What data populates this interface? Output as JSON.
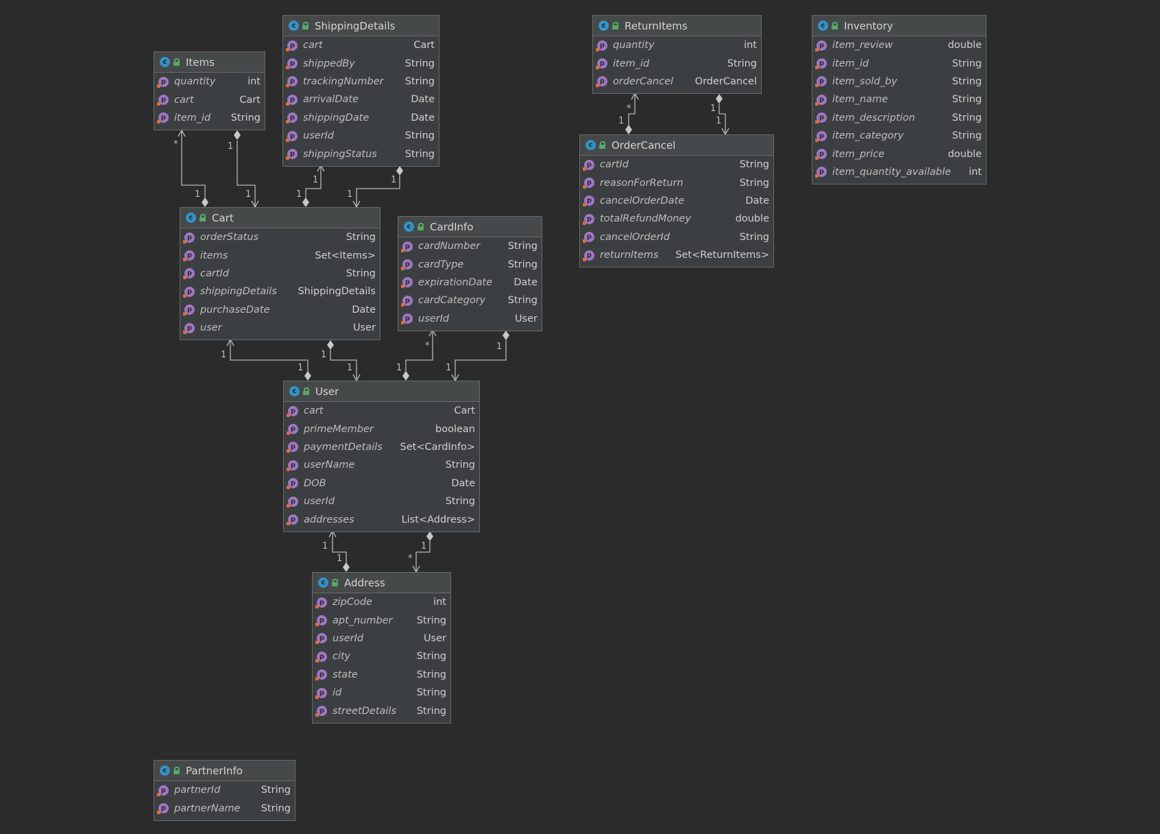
{
  "class_icon_letter": "c",
  "property_icon_letter": "p",
  "classes": [
    {
      "id": "items",
      "name": "Items",
      "fields": [
        {
          "name": "quantity",
          "type": "int"
        },
        {
          "name": "cart",
          "type": "Cart"
        },
        {
          "name": "item_id",
          "type": "String"
        }
      ]
    },
    {
      "id": "shippingdetails",
      "name": "ShippingDetails",
      "fields": [
        {
          "name": "cart",
          "type": "Cart"
        },
        {
          "name": "shippedBy",
          "type": "String"
        },
        {
          "name": "trackingNumber",
          "type": "String"
        },
        {
          "name": "arrivalDate",
          "type": "Date"
        },
        {
          "name": "shippingDate",
          "type": "Date"
        },
        {
          "name": "userId",
          "type": "String"
        },
        {
          "name": "shippingStatus",
          "type": "String"
        }
      ]
    },
    {
      "id": "returnitems",
      "name": "ReturnItems",
      "fields": [
        {
          "name": "quantity",
          "type": "int"
        },
        {
          "name": "item_id",
          "type": "String"
        },
        {
          "name": "orderCancel",
          "type": "OrderCancel"
        }
      ]
    },
    {
      "id": "inventory",
      "name": "Inventory",
      "fields": [
        {
          "name": "item_review",
          "type": "double"
        },
        {
          "name": "item_id",
          "type": "String"
        },
        {
          "name": "item_sold_by",
          "type": "String"
        },
        {
          "name": "item_name",
          "type": "String"
        },
        {
          "name": "item_description",
          "type": "String"
        },
        {
          "name": "item_category",
          "type": "String"
        },
        {
          "name": "item_price",
          "type": "double"
        },
        {
          "name": "item_quantity_available",
          "type": "int"
        }
      ]
    },
    {
      "id": "cart",
      "name": "Cart",
      "fields": [
        {
          "name": "orderStatus",
          "type": "String"
        },
        {
          "name": "items",
          "type": "Set<Items>"
        },
        {
          "name": "cartId",
          "type": "String"
        },
        {
          "name": "shippingDetails",
          "type": "ShippingDetails"
        },
        {
          "name": "purchaseDate",
          "type": "Date"
        },
        {
          "name": "user",
          "type": "User"
        }
      ]
    },
    {
      "id": "cardinfo",
      "name": "CardInfo",
      "fields": [
        {
          "name": "cardNumber",
          "type": "String"
        },
        {
          "name": "cardType",
          "type": "String"
        },
        {
          "name": "expirationDate",
          "type": "Date"
        },
        {
          "name": "cardCategory",
          "type": "String"
        },
        {
          "name": "userId",
          "type": "User"
        }
      ]
    },
    {
      "id": "ordercancel",
      "name": "OrderCancel",
      "fields": [
        {
          "name": "cartId",
          "type": "String"
        },
        {
          "name": "reasonForReturn",
          "type": "String"
        },
        {
          "name": "cancelOrderDate",
          "type": "Date"
        },
        {
          "name": "totalRefundMoney",
          "type": "double"
        },
        {
          "name": "cancelOrderId",
          "type": "String"
        },
        {
          "name": "returnItems",
          "type": "Set<ReturnItems>"
        }
      ]
    },
    {
      "id": "user",
      "name": "User",
      "fields": [
        {
          "name": "cart",
          "type": "Cart"
        },
        {
          "name": "primeMember",
          "type": "boolean"
        },
        {
          "name": "paymentDetails",
          "type": "Set<CardInfo>"
        },
        {
          "name": "userName",
          "type": "String"
        },
        {
          "name": "DOB",
          "type": "Date"
        },
        {
          "name": "userId",
          "type": "String"
        },
        {
          "name": "addresses",
          "type": "List<Address>"
        }
      ]
    },
    {
      "id": "address",
      "name": "Address",
      "fields": [
        {
          "name": "zipCode",
          "type": "int"
        },
        {
          "name": "apt_number",
          "type": "String"
        },
        {
          "name": "userId",
          "type": "User"
        },
        {
          "name": "city",
          "type": "String"
        },
        {
          "name": "state",
          "type": "String"
        },
        {
          "name": "id",
          "type": "String"
        },
        {
          "name": "streetDetails",
          "type": "String"
        }
      ]
    },
    {
      "id": "partnerinfo",
      "name": "PartnerInfo",
      "fields": [
        {
          "name": "partnerId",
          "type": "String"
        },
        {
          "name": "partnerName",
          "type": "String"
        }
      ]
    }
  ],
  "multiplicities": {
    "items_cart_a_star": "*",
    "items_cart_a_one": "1",
    "items_cart_b_one_top": "1",
    "items_cart_b_one_bottom": "1",
    "ship_cart_a_one_top": "1",
    "ship_cart_a_one_bottom": "1",
    "ship_cart_b_one_top": "1",
    "ship_cart_b_one_bottom": "1",
    "cart_user_a_one_top": "1",
    "cart_user_a_one_bottom": "1",
    "cart_user_b_one_top": "1",
    "cart_user_b_one_bottom": "1",
    "card_user_a_star": "*",
    "card_user_a_one": "1",
    "card_user_b_one_top": "1",
    "card_user_b_one_bottom": "1",
    "user_addr_a_one_top": "1",
    "user_addr_a_one_bottom": "1",
    "user_addr_b_one_top": "1",
    "user_addr_b_star": "*",
    "ret_oc_a_star": "*",
    "ret_oc_a_one": "1",
    "ret_oc_b_one_top": "1",
    "ret_oc_b_one_bottom": "1"
  }
}
